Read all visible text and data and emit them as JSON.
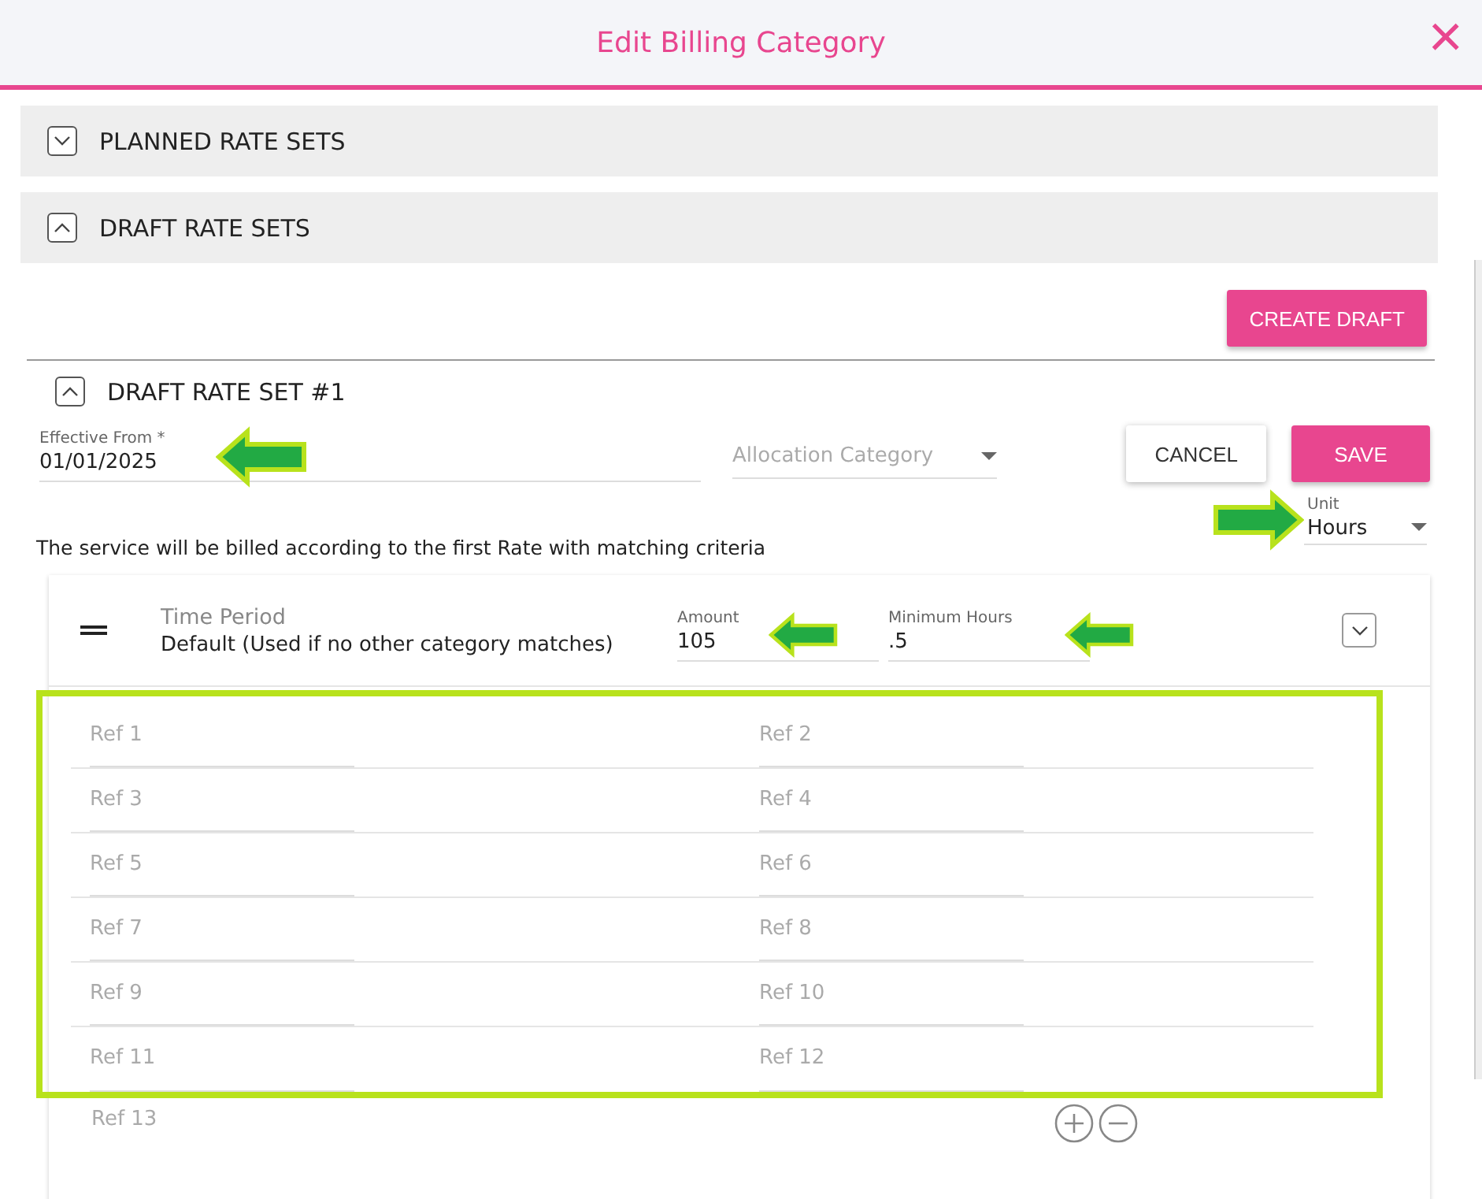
{
  "dialog": {
    "title": "Edit Billing Category",
    "close_glyph": "×"
  },
  "sections": [
    {
      "title": "PLANNED RATE SETS",
      "expanded": false
    },
    {
      "title": "DRAFT RATE SETS",
      "expanded": true
    }
  ],
  "create_button": "CREATE DRAFT",
  "rate_set": {
    "title": "DRAFT RATE SET #1",
    "expanded": true,
    "effective_from": {
      "label": "Effective From *",
      "value": "01/01/2025",
      "callout": {
        "points_right": false
      }
    },
    "allocation": {
      "placeholder": "Allocation Category"
    },
    "buttons": [
      {
        "label": "CANCEL",
        "kind": "outline"
      },
      {
        "label": "SAVE",
        "kind": "primary"
      }
    ],
    "unit": {
      "label": "Unit",
      "value": "Hours",
      "callout": {
        "points_right": true
      }
    },
    "note": "The service will be billed according to the first Rate with matching criteria",
    "rate": {
      "type_label": "Time Period",
      "description": "Default (Used if no other category matches)",
      "expanded": false,
      "amount": {
        "label": "Amount",
        "value": "105",
        "callout": {
          "points_right": false
        }
      },
      "minimum": {
        "label": "Minimum Hours",
        "value": ".5",
        "callout": {
          "points_right": false
        }
      },
      "refs_highlighted": true,
      "refs": [
        "Ref 1",
        "Ref 2",
        "Ref 3",
        "Ref 4",
        "Ref 5",
        "Ref 6",
        "Ref 7",
        "Ref 8",
        "Ref 9",
        "Ref 10",
        "Ref 11",
        "Ref 12"
      ],
      "extra_ref": "Ref 13"
    }
  }
}
